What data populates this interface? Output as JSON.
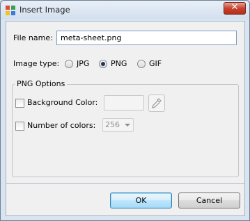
{
  "window": {
    "title": "Insert Image",
    "close_icon": "close-icon"
  },
  "file_name": {
    "label": "File name:",
    "value": "meta-sheet.png"
  },
  "image_type": {
    "label": "Image type:",
    "options": [
      {
        "label": "JPG",
        "checked": false
      },
      {
        "label": "PNG",
        "checked": true
      },
      {
        "label": "GIF",
        "checked": false
      }
    ]
  },
  "png_options": {
    "title": "PNG Options",
    "background_color": {
      "label": "Background Color:",
      "checked": false,
      "picker_icon": "eyedropper-icon"
    },
    "number_of_colors": {
      "label": "Number of colors:",
      "checked": false,
      "value": "256"
    }
  },
  "buttons": {
    "ok": "OK",
    "cancel": "Cancel"
  }
}
